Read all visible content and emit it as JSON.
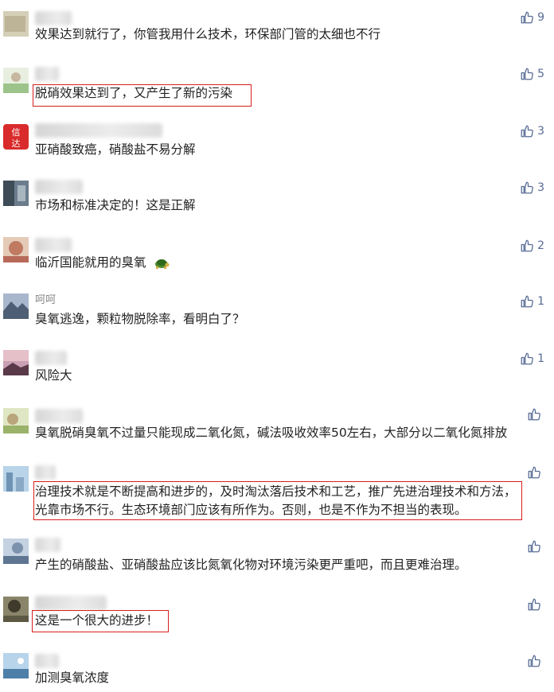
{
  "comments": [
    {
      "name": "",
      "text": "效果达到就行了，你管我用什么技术，环保部门管的太细也不行",
      "likes": "9",
      "avatar_color": "#c9c3a8"
    },
    {
      "name": "",
      "text": "脱硝效果达到了，又产生了新的污染",
      "likes": "5",
      "avatar_color": "#b9d6a8"
    },
    {
      "name": "",
      "text": "亚硝酸致癌，硝酸盐不易分解",
      "likes": "3",
      "avatar_color": "#d92b2b",
      "avatar_label": "信达"
    },
    {
      "name": "",
      "text": "市场和标准决定的！这是正解",
      "likes": "3",
      "avatar_color": "#5d7080"
    },
    {
      "name": "",
      "text": "临沂国能就用的臭氧",
      "likes": "2",
      "avatar_color": "#c98b73"
    },
    {
      "name": "呵呵",
      "text": "臭氧逃逸，颗粒物脱除率，看明白了？",
      "likes": "1",
      "avatar_color": "#7a8aa8"
    },
    {
      "name": "",
      "text": "风险大",
      "likes": "1",
      "avatar_color": "#8c5a6a"
    },
    {
      "name": "",
      "text": "臭氧脱硝臭氧不过量只能现成二氧化氮，碱法吸收效率50左右，大部分以二氧化氮排放",
      "likes": "",
      "avatar_color": "#c9d3a0"
    },
    {
      "name": "",
      "text": "治理技术就是不断提高和进步的，及时淘汰落后技术和工艺，推广先进治理技术和方法，光靠市场不行。生态环境部门应该有所作为。否则，也是不作为不担当的表现。",
      "likes": "",
      "avatar_color": "#8ab0d0"
    },
    {
      "name": "",
      "text": "产生的硝酸盐、亚硝酸盐应该比氮氧化物对环境污染更严重吧，而且更难治理。",
      "likes": "",
      "avatar_color": "#93a9c2"
    },
    {
      "name": "",
      "text": "这是一个很大的进步！",
      "likes": "",
      "avatar_color": "#6f6a55"
    },
    {
      "name": "",
      "text": "加测臭氧浓度",
      "likes": "",
      "avatar_color": "#7fa8c8"
    }
  ],
  "colors": {
    "like": "#576b95",
    "highlight": "#d81e1e",
    "text": "#222222"
  },
  "icons": {
    "like": "thumbs-up-icon",
    "emoji": "turtle-emoji-icon"
  }
}
